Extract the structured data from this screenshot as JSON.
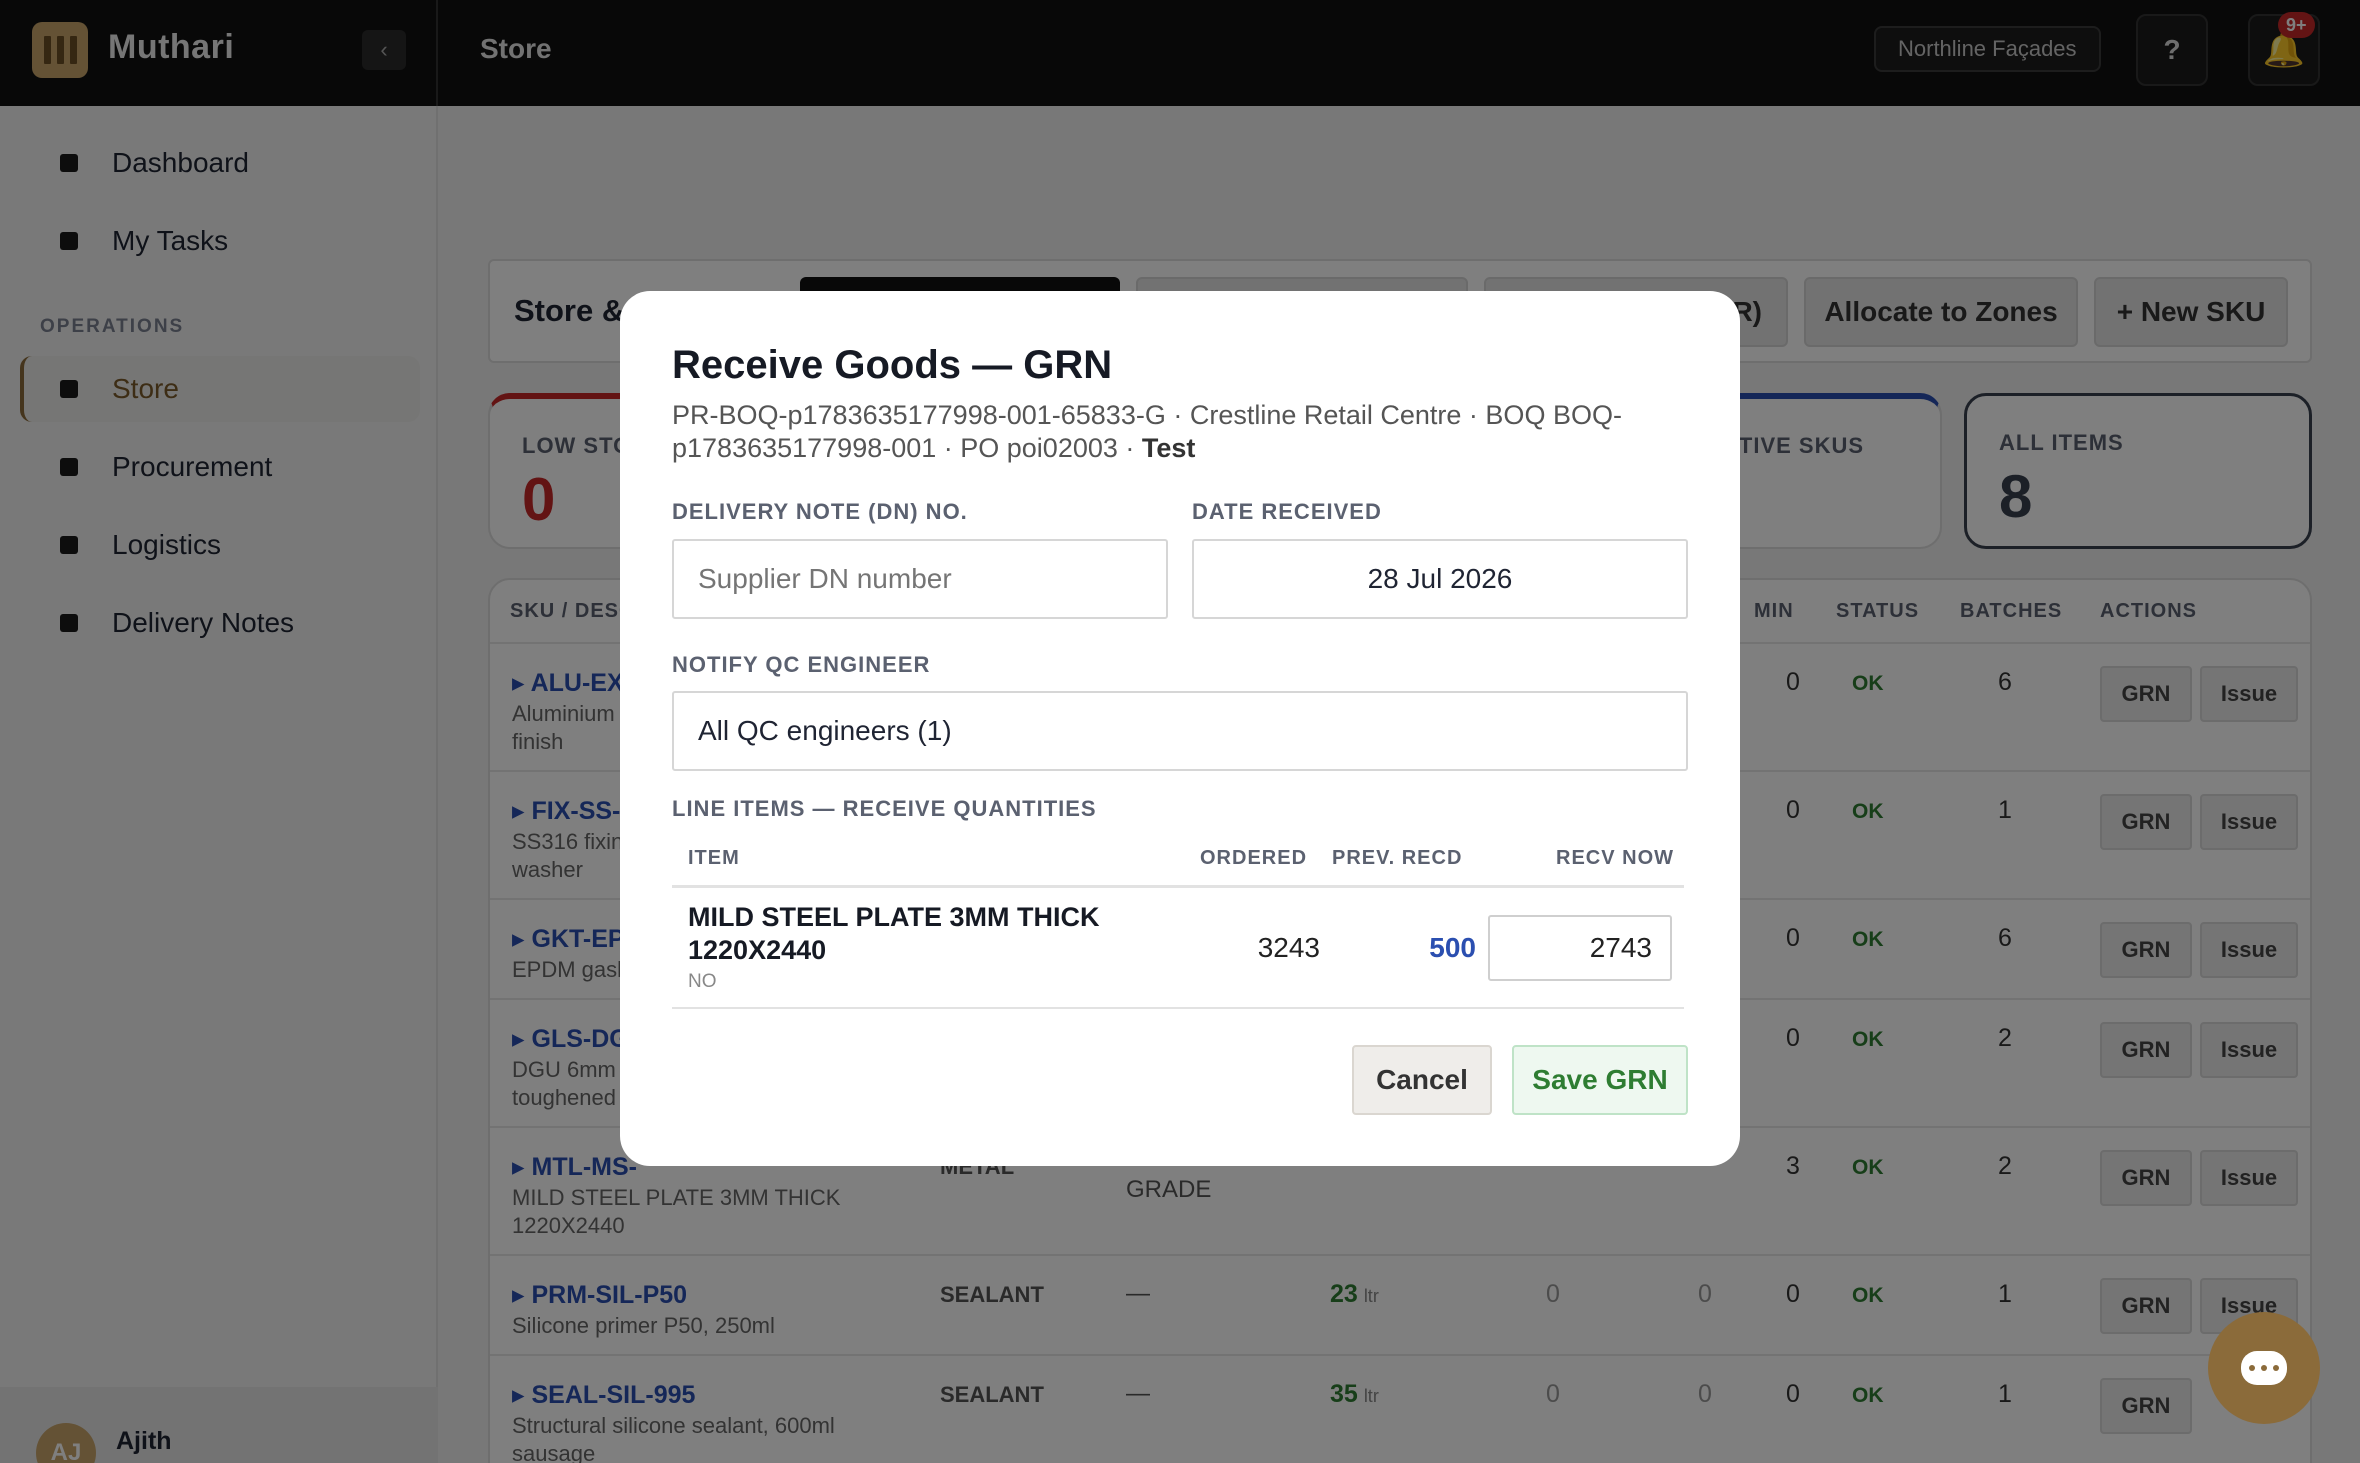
{
  "topbar": {
    "brand": "Muthari",
    "collapse_icon": "‹",
    "page_title": "Store",
    "org": "Northline Façades",
    "help_label": "?",
    "bell_icon": "🔔",
    "notification_badge": "9+"
  },
  "sidebar": {
    "items": [
      {
        "label": "Dashboard"
      },
      {
        "label": "My Tasks"
      },
      {
        "label": "Store",
        "active": true
      },
      {
        "label": "Procurement"
      },
      {
        "label": "Logistics"
      },
      {
        "label": "Delivery Notes"
      }
    ],
    "section_label": "OPERATIONS",
    "user": {
      "initials": "AJ",
      "name": "Ajith"
    }
  },
  "toolbar": {
    "title": "Store & I",
    "tab_partial": "R)",
    "allocate_label": "Allocate to Zones",
    "new_sku_label": "+ New SKU"
  },
  "stats": {
    "low_stock": {
      "label": "LOW STO",
      "value": "0"
    },
    "active_skus": {
      "label": "CTIVE SKUS"
    },
    "all_items": {
      "label": "ALL ITEMS",
      "value": "8"
    }
  },
  "table": {
    "headers": {
      "sku": "SKU / DESC",
      "min": "MIN",
      "status": "STATUS",
      "batches": "BATCHES",
      "actions": "ACTIONS"
    },
    "grn_label": "GRN",
    "issue_label": "Issue",
    "rows": [
      {
        "sku": "▸ ALU-EX",
        "desc": "Aluminium\nfinish",
        "min": "0",
        "status": "OK",
        "batches": "6"
      },
      {
        "sku": "▸ FIX-SS-",
        "desc": "SS316 fixin\nwasher",
        "min": "0",
        "status": "OK",
        "batches": "1"
      },
      {
        "sku": "▸ GKT-EP",
        "desc": "EPDM gask",
        "min": "0",
        "status": "OK",
        "batches": "6"
      },
      {
        "sku": "▸ GLS-DG",
        "desc": "DGU 6mm\ntoughened",
        "min": "0",
        "status": "OK",
        "batches": "2"
      },
      {
        "sku": "▸ MTL-MS-",
        "desc": "MILD STEEL PLATE 3MM THICK\n1220X2440",
        "category": "METAL",
        "spec": "GRADE",
        "min": "3",
        "status": "OK",
        "batches": "2"
      },
      {
        "sku": "▸ PRM-SIL-P50",
        "desc": "Silicone primer P50, 250ml",
        "category": "SEALANT",
        "spec": "—",
        "qty": "23",
        "unit": "ltr",
        "c1": "0",
        "c2": "0",
        "min": "0",
        "status": "OK",
        "batches": "1"
      },
      {
        "sku": "▸ SEAL-SIL-995",
        "desc": "Structural silicone sealant, 600ml\nsausage",
        "category": "SEALANT",
        "spec": "—",
        "qty": "35",
        "unit": "ltr",
        "c1": "0",
        "c2": "0",
        "min": "0",
        "status": "OK",
        "batches": "1"
      }
    ]
  },
  "modal": {
    "title": "Receive Goods — GRN",
    "subtitle": "PR-BOQ-p1783635177998-001-65833-G · Crestline Retail Centre · BOQ BOQ-p1783635177998-001 · PO poi02003 · ",
    "subtitle_bold": "Test",
    "dn_label": "DELIVERY NOTE (DN) NO.",
    "dn_placeholder": "Supplier DN number",
    "date_label": "DATE RECEIVED",
    "date_value": "28 Jul 2026",
    "qc_label": "NOTIFY QC ENGINEER",
    "qc_value": "All QC engineers (1)",
    "line_items_label": "LINE ITEMS — RECEIVE QUANTITIES",
    "columns": {
      "item": "ITEM",
      "ordered": "ORDERED",
      "prev": "PREV. RECD",
      "recv": "RECV NOW"
    },
    "line_item": {
      "name": "MILD STEEL PLATE 3MM THICK 1220X2440",
      "unit": "NO",
      "ordered": "3243",
      "prev_received": "500",
      "receive_now": "2743"
    },
    "cancel_label": "Cancel",
    "save_label": "Save GRN"
  }
}
